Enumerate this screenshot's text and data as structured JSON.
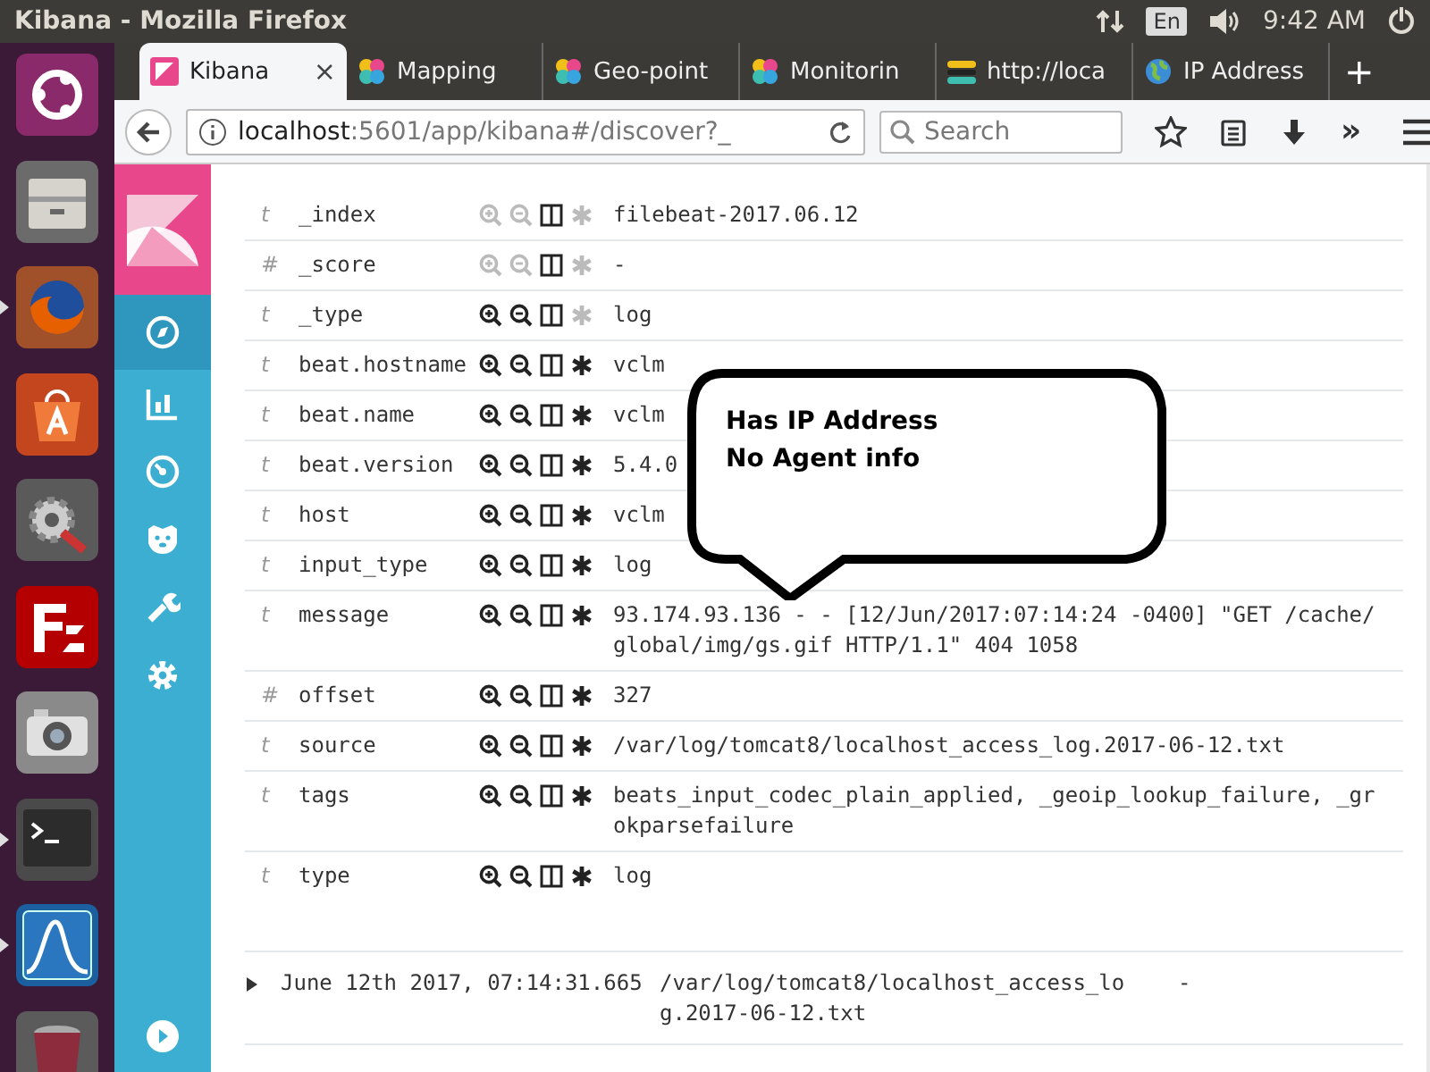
{
  "os_bar": {
    "title": "Kibana - Mozilla Firefox",
    "keyboard": "En",
    "clock": "9:42 AM"
  },
  "launcher": [
    {
      "kind": "dash",
      "running": false
    },
    {
      "kind": "files",
      "running": false
    },
    {
      "kind": "firefox",
      "running": true
    },
    {
      "kind": "software",
      "running": false
    },
    {
      "kind": "settings",
      "running": false
    },
    {
      "kind": "filezilla",
      "running": false
    },
    {
      "kind": "camera",
      "running": false
    },
    {
      "kind": "terminal",
      "running": true
    },
    {
      "kind": "wireshark",
      "running": true
    },
    {
      "kind": "trash",
      "running": false
    }
  ],
  "tabs": [
    {
      "label": "Kibana",
      "kind": "kibana",
      "selected": true,
      "close": "×"
    },
    {
      "label": "Mapping",
      "kind": "elastic",
      "selected": false
    },
    {
      "label": "Geo-point",
      "kind": "elastic",
      "selected": false
    },
    {
      "label": "Monitorin",
      "kind": "elastic",
      "selected": false
    },
    {
      "label": "http://loca",
      "kind": "stack",
      "selected": false
    },
    {
      "label": "IP Address",
      "kind": "globe",
      "selected": false
    }
  ],
  "new_tab": "+",
  "navbar": {
    "url_host": "localhost",
    "url_rest": ":5601/app/kibana#/discover?_",
    "search": {
      "placeholder": "Search"
    },
    "overflow": "»"
  },
  "kibana_nav": [
    {
      "kind": "discover",
      "selected": true
    },
    {
      "kind": "visualize",
      "selected": false
    },
    {
      "kind": "dashboard",
      "selected": false
    },
    {
      "kind": "timelion",
      "selected": false
    },
    {
      "kind": "devtools",
      "selected": false
    },
    {
      "kind": "management",
      "selected": false
    }
  ],
  "fields": [
    {
      "type": "t",
      "name": "_index",
      "value": "filebeat-2017.06.12",
      "filterable": false,
      "exists_filter": false
    },
    {
      "type": "#",
      "name": "_score",
      "value": "-",
      "filterable": false,
      "exists_filter": false
    },
    {
      "type": "t",
      "name": "_type",
      "value": "log",
      "filterable": true,
      "exists_filter": false
    },
    {
      "type": "t",
      "name": "beat.hostname",
      "value": "vclm",
      "filterable": true,
      "exists_filter": true
    },
    {
      "type": "t",
      "name": "beat.name",
      "value": "vclm",
      "filterable": true,
      "exists_filter": true
    },
    {
      "type": "t",
      "name": "beat.version",
      "value": "5.4.0",
      "filterable": true,
      "exists_filter": true
    },
    {
      "type": "t",
      "name": "host",
      "value": "vclm",
      "filterable": true,
      "exists_filter": true
    },
    {
      "type": "t",
      "name": "input_type",
      "value": "log",
      "filterable": true,
      "exists_filter": true
    },
    {
      "type": "t",
      "name": "message",
      "value": "93.174.93.136 - - [12/Jun/2017:07:14:24 -0400] \"GET /cache/global/img/gs.gif HTTP/1.1\" 404 1058",
      "filterable": true,
      "exists_filter": true
    },
    {
      "type": "#",
      "name": "offset",
      "value": "327",
      "filterable": true,
      "exists_filter": true
    },
    {
      "type": "t",
      "name": "source",
      "value": "/var/log/tomcat8/localhost_access_log.2017-06-12.txt",
      "filterable": true,
      "exists_filter": true
    },
    {
      "type": "t",
      "name": "tags",
      "value": "beats_input_codec_plain_applied, _geoip_lookup_failure, _grokparsefailure",
      "filterable": true,
      "exists_filter": true
    },
    {
      "type": "t",
      "name": "type",
      "value": "log",
      "filterable": true,
      "exists_filter": true
    }
  ],
  "document": {
    "expanded": false,
    "time": "June 12th 2017, 07:14:31.665",
    "source": "/var/log/tomcat8/localhost_access_log.2017-06-12.txt",
    "column_3": "-"
  },
  "callout": [
    "Has IP Address",
    "No Agent info"
  ]
}
